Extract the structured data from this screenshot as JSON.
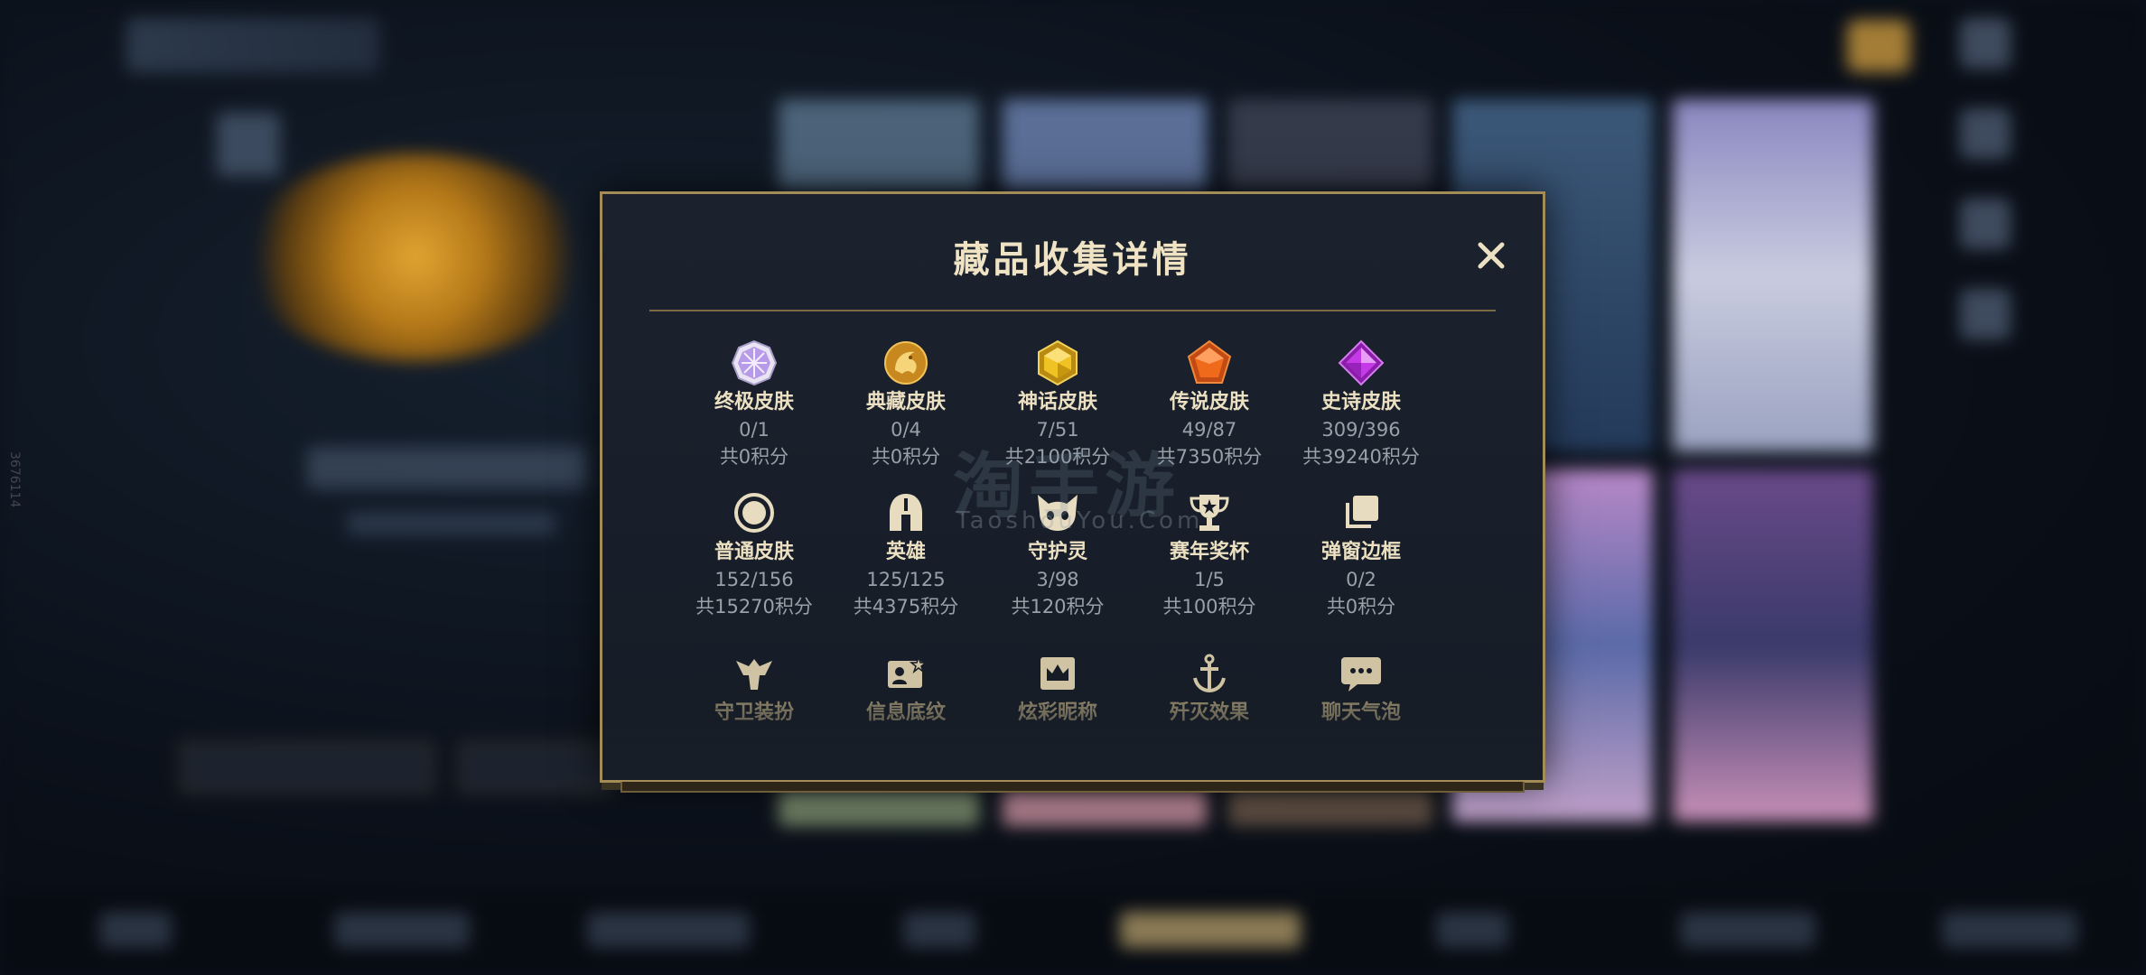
{
  "dialog": {
    "title": "藏品收集详情",
    "close_label": "✕",
    "rows": [
      [
        {
          "name": "终极皮肤",
          "count": "0/1",
          "points": "共0积分",
          "icon": "ultimate-skin-gem-icon"
        },
        {
          "name": "典藏皮肤",
          "count": "0/4",
          "points": "共0积分",
          "icon": "legendary-collection-dragon-icon"
        },
        {
          "name": "神话皮肤",
          "count": "7/51",
          "points": "共2100积分",
          "icon": "mythic-skin-gem-icon"
        },
        {
          "name": "传说皮肤",
          "count": "49/87",
          "points": "共7350积分",
          "icon": "legend-skin-gem-icon"
        },
        {
          "name": "史诗皮肤",
          "count": "309/396",
          "points": "共39240积分",
          "icon": "epic-skin-gem-icon"
        }
      ],
      [
        {
          "name": "普通皮肤",
          "count": "152/156",
          "points": "共15270积分",
          "icon": "normal-skin-ring-icon"
        },
        {
          "name": "英雄",
          "count": "125/125",
          "points": "共4375积分",
          "icon": "hero-helmet-icon"
        },
        {
          "name": "守护灵",
          "count": "3/98",
          "points": "共120积分",
          "icon": "guardian-spirit-icon"
        },
        {
          "name": "赛年奖杯",
          "count": "1/5",
          "points": "共100积分",
          "icon": "trophy-icon"
        },
        {
          "name": "弹窗边框",
          "count": "0/2",
          "points": "共0积分",
          "icon": "popup-frame-icon"
        }
      ],
      [
        {
          "name": "守卫装扮",
          "icon": "guard-outfit-icon"
        },
        {
          "name": "信息底纹",
          "icon": "info-background-icon"
        },
        {
          "name": "炫彩昵称",
          "icon": "colorful-nickname-icon"
        },
        {
          "name": "歼灭效果",
          "icon": "elimination-effect-icon"
        },
        {
          "name": "聊天气泡",
          "icon": "chat-bubble-icon"
        }
      ]
    ]
  },
  "watermark": {
    "main": "淘手游",
    "sub": "TaoshouYou.Com"
  },
  "background": {
    "side_id": "3676114"
  },
  "colors": {
    "accent_gold": "#a48c57",
    "title_text": "#efe3c4",
    "muted_text": "#9aa0a8"
  }
}
